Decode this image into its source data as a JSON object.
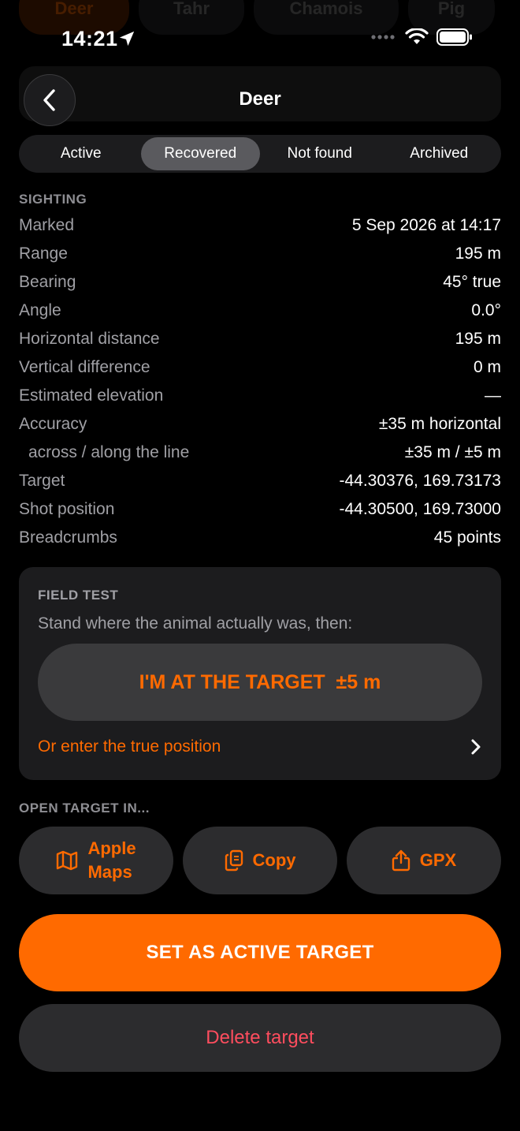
{
  "status_bar": {
    "time": "14:21"
  },
  "background": {
    "chips": [
      "Deer",
      "Tahr",
      "Chamois",
      "Pig"
    ]
  },
  "header": {
    "title": "Deer"
  },
  "tabs": [
    {
      "label": "Active"
    },
    {
      "label": "Recovered",
      "selected": true
    },
    {
      "label": "Not found"
    },
    {
      "label": "Archived"
    }
  ],
  "sighting": {
    "title": "SIGHTING",
    "rows": [
      {
        "label": "Marked",
        "value": "5 Sep 2026 at 14:17"
      },
      {
        "label": "Range",
        "value": "195 m"
      },
      {
        "label": "Bearing",
        "value": "45° true"
      },
      {
        "label": "Angle",
        "value": "0.0°"
      },
      {
        "label": "Horizontal distance",
        "value": "195 m"
      },
      {
        "label": "Vertical difference",
        "value": "0 m"
      },
      {
        "label": "Estimated elevation",
        "value": "—"
      },
      {
        "label": "Accuracy",
        "value": "±35 m horizontal"
      },
      {
        "label": "across / along the line",
        "value": "±35 m / ±5 m"
      },
      {
        "label": "Target",
        "value": "-44.30376, 169.73173"
      },
      {
        "label": "Shot position",
        "value": "-44.30500, 169.73000"
      },
      {
        "label": "Breadcrumbs",
        "value": "45 points"
      }
    ]
  },
  "field_test": {
    "title": "FIELD TEST",
    "description": "Stand where the animal actually was, then:",
    "button_label": "I'M AT THE TARGET  ±5 m",
    "enter_link": "Or enter the true position"
  },
  "open_target": {
    "title": "OPEN TARGET IN...",
    "apple_maps_line1": "Apple",
    "apple_maps_line2": "Maps",
    "copy_label": "Copy",
    "gpx_label": "GPX"
  },
  "actions": {
    "set_active_label": "SET AS ACTIVE TARGET",
    "delete_label": "Delete target"
  },
  "colors": {
    "accent": "#ff6a00",
    "destructive": "#ff4d5e",
    "background": "#000000",
    "surface": "#1c1c1e"
  }
}
